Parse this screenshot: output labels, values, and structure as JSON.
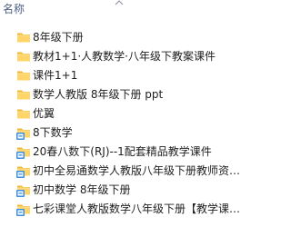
{
  "header": {
    "name_column_label": "名称"
  },
  "files": [
    {
      "name": "8年级下册",
      "icon": "folder-icon"
    },
    {
      "name": "教材1+1·人教数学·八年级下教案课件",
      "icon": "folder-icon"
    },
    {
      "name": "课件1+1",
      "icon": "folder-icon"
    },
    {
      "name": "数学人教版 8年级下册 ppt",
      "icon": "folder-icon"
    },
    {
      "name": "优翼",
      "icon": "folder-icon"
    },
    {
      "name": "8下数学",
      "icon": "shared-folder-icon"
    },
    {
      "name": "20春八数下(RJ)--1配套精品教学课件",
      "icon": "shared-folder-icon"
    },
    {
      "name": "初中全易通数学人教版八年级下册教师资…",
      "icon": "shared-folder-icon"
    },
    {
      "name": "初中数学 8年级下册",
      "icon": "shared-folder-icon"
    },
    {
      "name": "七彩课堂人教版数学八年级下册【教学课…",
      "icon": "shared-folder-icon"
    }
  ],
  "colors": {
    "header_text": "#4d6082",
    "folder_body": "#ffd56a",
    "folder_tab": "#f2b634",
    "shared_folder_blue": "#3d8fe0"
  }
}
